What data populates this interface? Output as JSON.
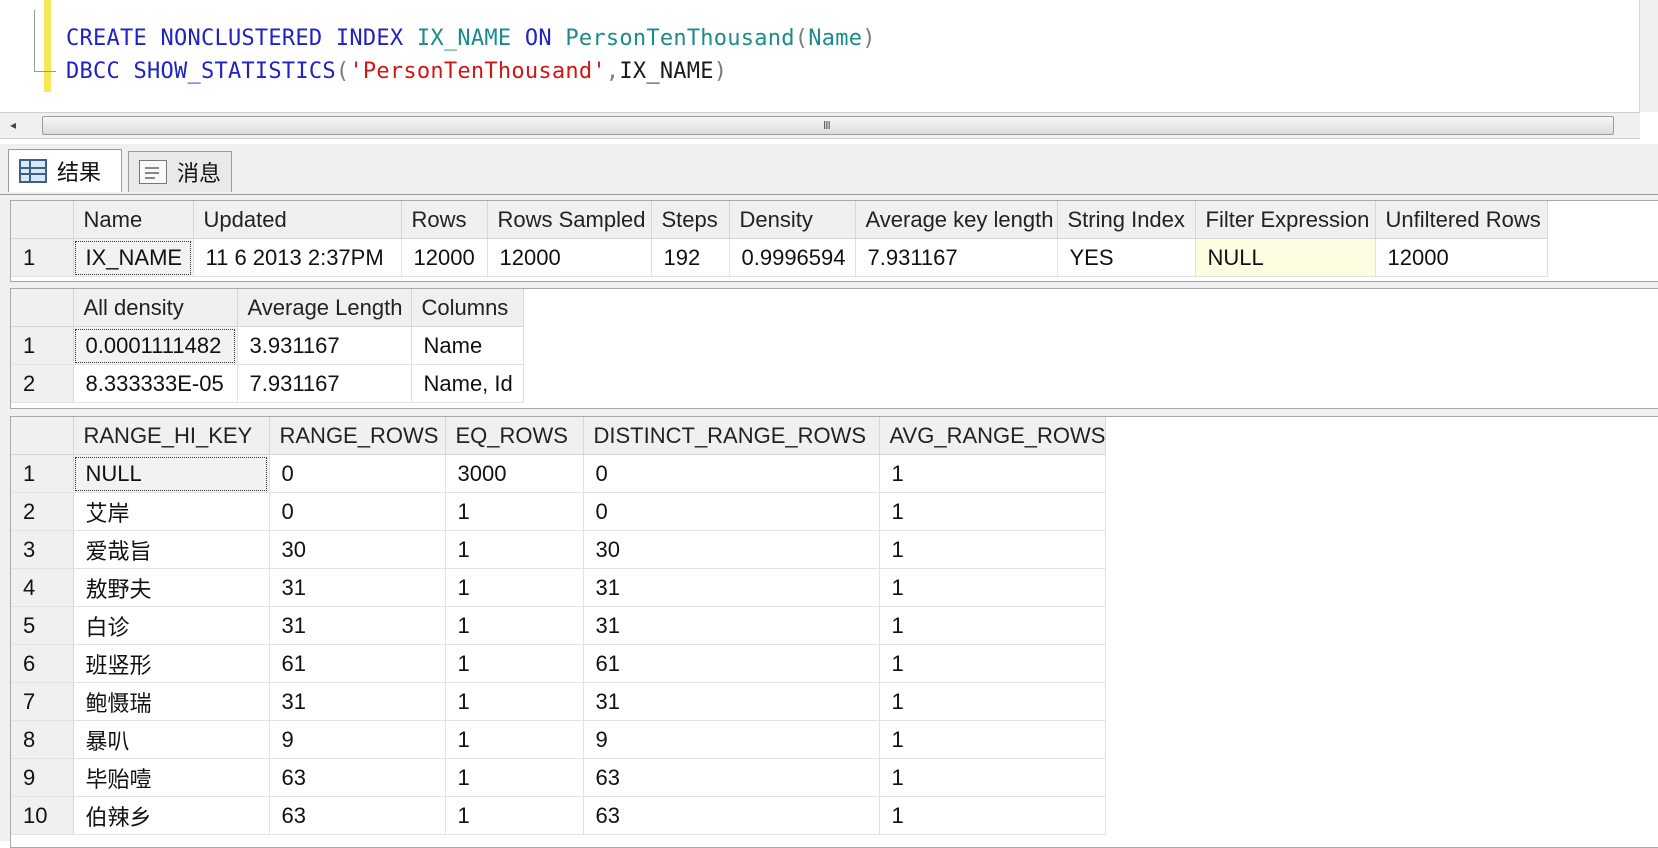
{
  "editor": {
    "line1": {
      "t1": "CREATE NONCLUSTERED INDEX",
      "t2": "IX_NAME",
      "t3": "ON",
      "t4": "PersonTenThousand",
      "t5": "(",
      "t6": "Name",
      "t7": ")"
    },
    "line2": {
      "t1": "DBCC SHOW_STATISTICS",
      "t2": "(",
      "t3": "'PersonTenThousand'",
      "t4": ",",
      "t5": "IX_NAME",
      "t6": ")"
    }
  },
  "scrollbar": {
    "left_arrow": "◂",
    "grip": "III"
  },
  "tabs": {
    "results": "结果",
    "messages": "消息"
  },
  "grid1": {
    "headers": [
      "Name",
      "Updated",
      "Rows",
      "Rows Sampled",
      "Steps",
      "Density",
      "Average key length",
      "String Index",
      "Filter Expression",
      "Unfiltered Rows"
    ],
    "rows": [
      [
        "1",
        "IX_NAME",
        "11  6 2013  2:37PM",
        "12000",
        "12000",
        "192",
        "0.9996594",
        "7.931167",
        "YES",
        "NULL",
        "12000"
      ]
    ]
  },
  "grid2": {
    "headers": [
      "All density",
      "Average Length",
      "Columns"
    ],
    "rows": [
      [
        "1",
        "0.0001111482",
        "3.931167",
        "Name"
      ],
      [
        "2",
        "8.333333E-05",
        "7.931167",
        "Name, Id"
      ]
    ]
  },
  "grid3": {
    "headers": [
      "RANGE_HI_KEY",
      "RANGE_ROWS",
      "EQ_ROWS",
      "DISTINCT_RANGE_ROWS",
      "AVG_RANGE_ROWS"
    ],
    "rows": [
      [
        "1",
        "NULL",
        "0",
        "3000",
        "0",
        "1"
      ],
      [
        "2",
        "艾岸",
        "0",
        "1",
        "0",
        "1"
      ],
      [
        "3",
        "爱哉旨",
        "30",
        "1",
        "30",
        "1"
      ],
      [
        "4",
        "敖野夫",
        "31",
        "1",
        "31",
        "1"
      ],
      [
        "5",
        "白诊",
        "31",
        "1",
        "31",
        "1"
      ],
      [
        "6",
        "班竖形",
        "61",
        "1",
        "61",
        "1"
      ],
      [
        "7",
        "鲍慑瑞",
        "31",
        "1",
        "31",
        "1"
      ],
      [
        "8",
        "暴叭",
        "9",
        "1",
        "9",
        "1"
      ],
      [
        "9",
        "毕贻噎",
        "63",
        "1",
        "63",
        "1"
      ],
      [
        "10",
        "伯辣乡",
        "63",
        "1",
        "63",
        "1"
      ]
    ]
  }
}
